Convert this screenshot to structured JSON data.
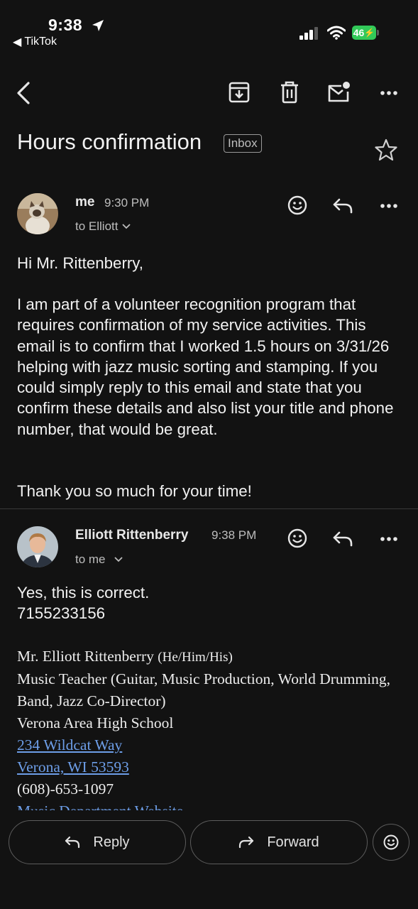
{
  "status_bar": {
    "time": "9:38",
    "back_app": "TikTok",
    "battery": "46"
  },
  "email": {
    "subject": "Hours confirmation",
    "label": "Inbox"
  },
  "message1": {
    "sender": "me",
    "time": "9:30 PM",
    "to": "to Elliott",
    "greeting": "Hi Mr. Rittenberry,",
    "paragraph": "I am part of a volunteer recognition program that requires confirmation of my service activities. This email is to confirm that I worked 1.5 hours on 3/31/26 helping with jazz music sorting and stamping. If you could simply reply to this email and state that you confirm these details and also list your title and phone number, that would be great.",
    "closing": "Thank you so much for your time!"
  },
  "message2": {
    "sender": "Elliott Rittenberry",
    "time": "9:38 PM",
    "to": "to me",
    "line1": "Yes, this is correct.",
    "line2": "7155233156",
    "signature": {
      "name": "Mr. Elliott Rittenberry",
      "pronouns": "(He/Him/His)",
      "title": "Music Teacher (Guitar, Music Production, World Drumming, Band, Jazz Co-Director)",
      "school": "Verona Area High School",
      "address1": "234 Wildcat Way",
      "address2": "Verona, WI 53593",
      "phone": "(608)-653-1097",
      "website": "Music Department Website"
    }
  },
  "actions": {
    "reply": "Reply",
    "forward": "Forward"
  },
  "colors": {
    "background": "#121212",
    "link": "#6d9ee8",
    "battery": "#32c959"
  }
}
